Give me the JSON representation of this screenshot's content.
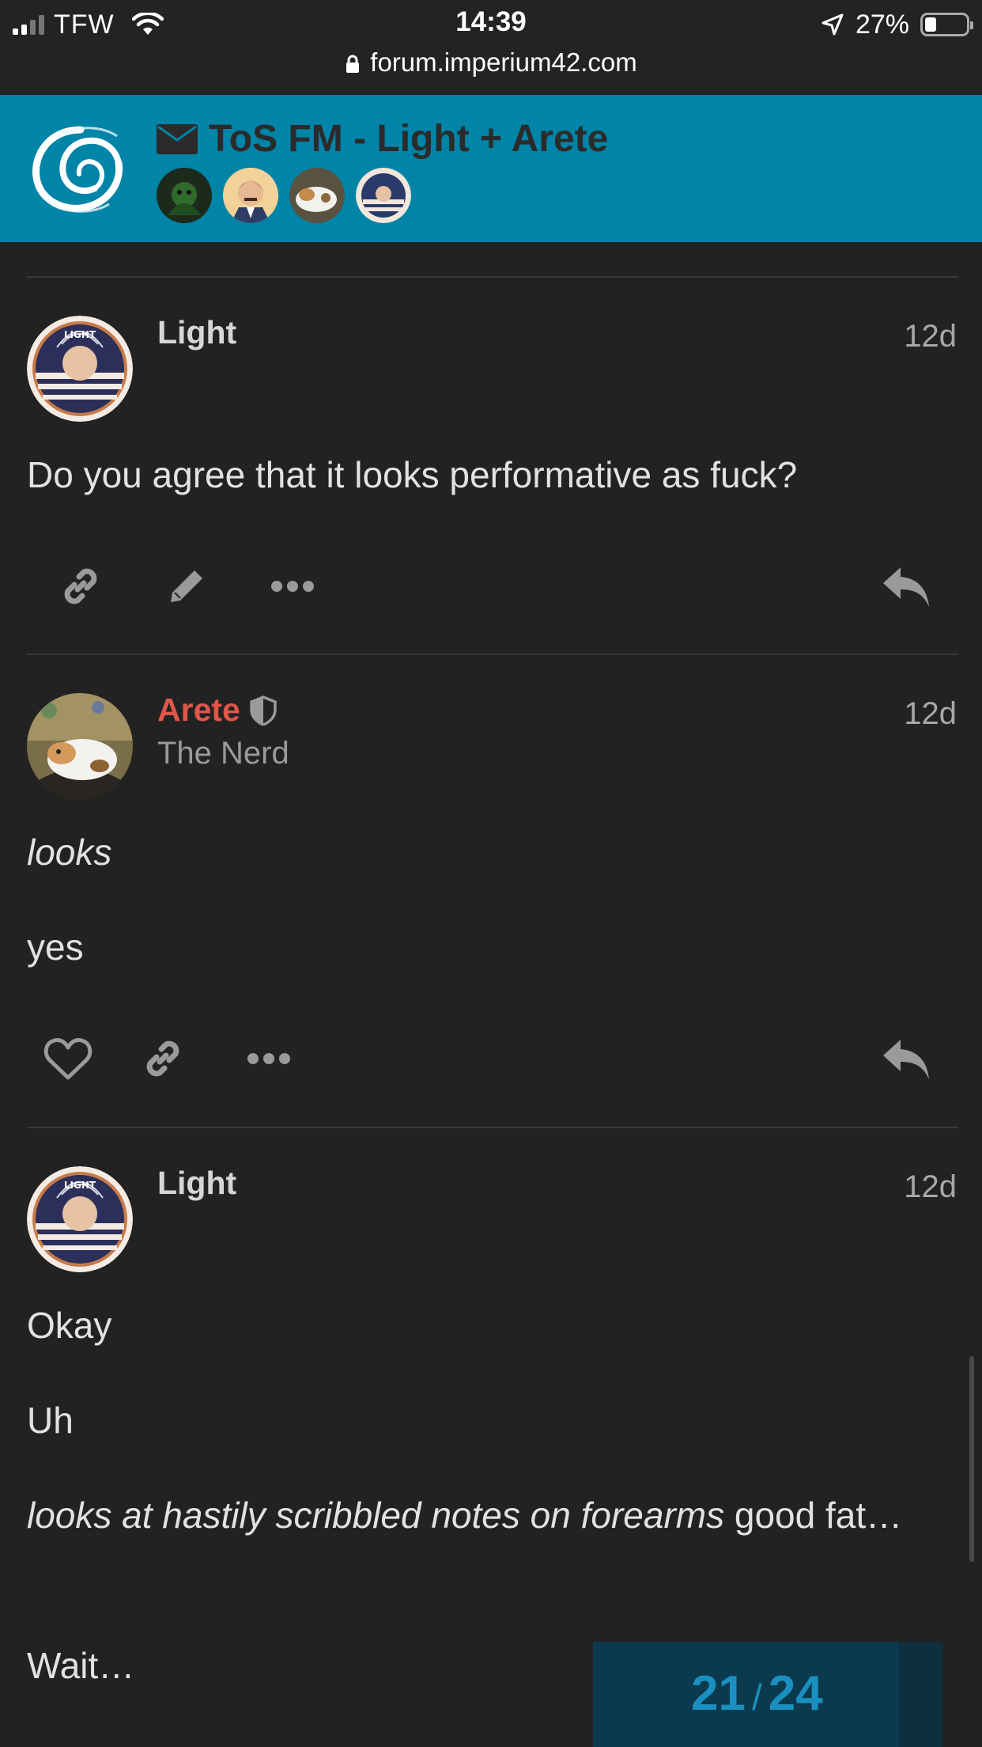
{
  "status_bar": {
    "carrier": "TFW",
    "time": "14:39",
    "battery_percent": "27%",
    "battery_level": 0.27,
    "url": "forum.imperium42.com"
  },
  "header": {
    "topic_title": "ToS FM - Light + Arete",
    "participants": [
      "participant-1",
      "participant-2",
      "participant-3",
      "participant-4"
    ]
  },
  "posts": [
    {
      "username": "Light",
      "date": "12d",
      "body": "Do you agree that it looks performative as fuck?",
      "actions": [
        "link-icon",
        "edit-icon",
        "more-icon",
        "reply-icon"
      ]
    },
    {
      "username": "Arete",
      "user_title": "The Nerd",
      "date": "12d",
      "body_lines": [
        "looks",
        "yes"
      ],
      "actions": [
        "heart-icon",
        "link-icon",
        "more-icon",
        "reply-icon"
      ]
    },
    {
      "username": "Light",
      "date": "12d",
      "body_lines": [
        "Okay",
        "Uh"
      ],
      "italic_part": "looks at hastily scribbled notes on forearms",
      "normal_part": " good fat…",
      "last_line": "Wait…"
    }
  ],
  "progress": {
    "current": "21",
    "total": "24"
  },
  "colors": {
    "header_bg": "#0084a7",
    "page_bg": "#222222",
    "staff_name": "#e0564b",
    "progress_text": "#1a8fc0"
  }
}
